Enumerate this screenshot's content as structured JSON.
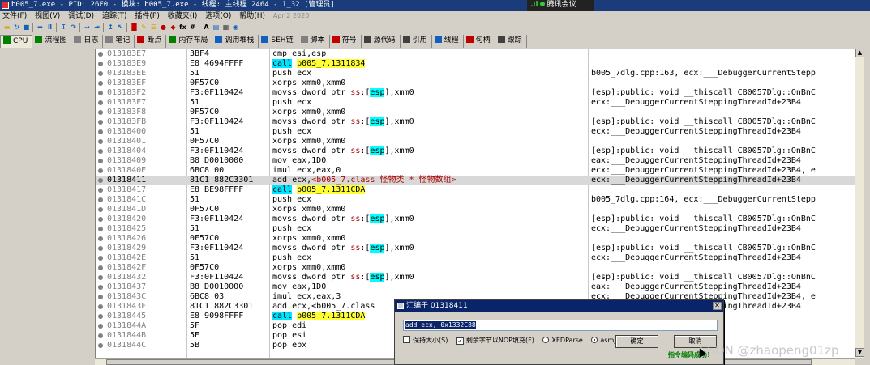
{
  "window": {
    "title": "b005_7.exe - PID: 26F0 - 模块: b005_7.exe - 线程: 主线程 2464 - 1_32 [管理员]",
    "meeting_label": "腾讯会议"
  },
  "menu": {
    "items": [
      "文件(F)",
      "视图(V)",
      "调试(D)",
      "追踪(T)",
      "插件(P)",
      "收藏夹(I)",
      "选项(O)",
      "帮助(H)"
    ],
    "date": "Apr 2 2020"
  },
  "toolbar": {
    "icons": [
      {
        "name": "open-icon",
        "color": "#d9a400",
        "glyph": "▬"
      },
      {
        "name": "restart-icon",
        "color": "#1060c0",
        "glyph": "↻"
      },
      {
        "name": "close-icon",
        "color": "#1060c0",
        "glyph": "■"
      },
      {
        "sep": true
      },
      {
        "name": "run-icon",
        "color": "#1060c0",
        "glyph": "➡"
      },
      {
        "name": "pause-icon",
        "color": "#1060c0",
        "glyph": "Ⅱ"
      },
      {
        "sep": true
      },
      {
        "name": "step-into-icon",
        "color": "#1060c0",
        "glyph": "↧"
      },
      {
        "name": "step-over-icon",
        "color": "#1060c0",
        "glyph": "↷"
      },
      {
        "sep": true
      },
      {
        "name": "trace-into-icon",
        "color": "#1060c0",
        "glyph": "⇢"
      },
      {
        "name": "trace-over-icon",
        "color": "#1060c0",
        "glyph": "⇥"
      },
      {
        "sep": true
      },
      {
        "name": "run-to-user-icon",
        "color": "#1060c0",
        "glyph": "↥"
      },
      {
        "name": "run-until-ret-icon",
        "color": "#1060c0",
        "glyph": "↖"
      },
      {
        "sep": true
      },
      {
        "name": "scylla-icon",
        "color": "#c00000",
        "glyph": "█"
      },
      {
        "name": "patch-icon",
        "color": "#d9a400",
        "glyph": "✎"
      },
      {
        "name": "script-icon",
        "color": "#d9a400",
        "glyph": "☰"
      },
      {
        "name": "breakpoint-icon",
        "color": "#c00000",
        "glyph": "●"
      },
      {
        "name": "hide-debugger-icon",
        "color": "#c00000",
        "glyph": "◆"
      },
      {
        "name": "function-icon",
        "color": "#000000",
        "glyph": "fx"
      },
      {
        "name": "hash-icon",
        "color": "#000000",
        "glyph": "#"
      },
      {
        "sep": true
      },
      {
        "name": "font-icon",
        "color": "#000000",
        "glyph": "A"
      },
      {
        "name": "clipboard-icon",
        "color": "#1060c0",
        "glyph": "▤"
      },
      {
        "name": "calculator-icon",
        "color": "#404040",
        "glyph": "▦"
      },
      {
        "name": "globe-icon",
        "color": "#1060c0",
        "glyph": "◉"
      }
    ]
  },
  "tabs": [
    {
      "label": "CPU",
      "icon": "cpu-icon",
      "color": "#008000",
      "active": true
    },
    {
      "label": "流程图",
      "icon": "graph-icon",
      "color": "#008000"
    },
    {
      "label": "日志",
      "icon": "log-icon",
      "color": "#808080"
    },
    {
      "label": "笔记",
      "icon": "notes-icon",
      "color": "#808080"
    },
    {
      "label": "断点",
      "icon": "breakpoint-tab-icon",
      "color": "#c00000"
    },
    {
      "label": "内存布局",
      "icon": "memory-icon",
      "color": "#008000"
    },
    {
      "label": "调用堆栈",
      "icon": "callstack-icon",
      "color": "#1060c0"
    },
    {
      "label": "SEH链",
      "icon": "seh-icon",
      "color": "#1060c0"
    },
    {
      "label": "脚本",
      "icon": "script-tab-icon",
      "color": "#808080"
    },
    {
      "label": "符号",
      "icon": "symbols-icon",
      "color": "#c00000"
    },
    {
      "label": "源代码",
      "icon": "source-icon",
      "color": "#404040"
    },
    {
      "label": "引用",
      "icon": "references-icon",
      "color": "#404040"
    },
    {
      "label": "线程",
      "icon": "threads-icon",
      "color": "#1060c0"
    },
    {
      "label": "句柄",
      "icon": "handles-icon",
      "color": "#c00000"
    },
    {
      "label": "跟踪",
      "icon": "trace-icon",
      "color": "#404040"
    }
  ],
  "disasm": {
    "rows": [
      {
        "addr": "013183E7",
        "hex": "3BF4",
        "dis": [
          {
            "t": "cmp esi,esp"
          }
        ],
        "cmt": ""
      },
      {
        "addr": "013183E9",
        "hex": "E8 4694FFFF",
        "dis": [
          {
            "t": "call",
            "c": "kw-call"
          },
          {
            "t": " "
          },
          {
            "t": "b005_7.1311834",
            "c": "sym"
          }
        ],
        "cmt": ""
      },
      {
        "addr": "013183EE",
        "hex": "51",
        "dis": [
          {
            "t": "push ecx"
          }
        ],
        "cmt": "b005_7dlg.cpp:163, ecx:___DebuggerCurrentStepp"
      },
      {
        "addr": "013183EF",
        "hex": "0F57C0",
        "dis": [
          {
            "t": "xorps xmm0,xmm0"
          }
        ],
        "cmt": ""
      },
      {
        "addr": "013183F2",
        "hex": "F3:0F110424",
        "dis": [
          {
            "t": "movss dword ptr "
          },
          {
            "t": "ss",
            "c": "seg"
          },
          {
            "t": ":["
          },
          {
            "t": "esp",
            "c": "memref"
          },
          {
            "t": "],xmm0"
          }
        ],
        "cmt": "[esp]:public: void __thiscall CB0057Dlg::OnBnC"
      },
      {
        "addr": "013183F7",
        "hex": "51",
        "dis": [
          {
            "t": "push ecx"
          }
        ],
        "cmt": "ecx:___DebuggerCurrentSteppingThreadId+23B4"
      },
      {
        "addr": "013183F8",
        "hex": "0F57C0",
        "dis": [
          {
            "t": "xorps xmm0,xmm0"
          }
        ],
        "cmt": ""
      },
      {
        "addr": "013183FB",
        "hex": "F3:0F110424",
        "dis": [
          {
            "t": "movss dword ptr "
          },
          {
            "t": "ss",
            "c": "seg"
          },
          {
            "t": ":["
          },
          {
            "t": "esp",
            "c": "memref"
          },
          {
            "t": "],xmm0"
          }
        ],
        "cmt": "[esp]:public: void __thiscall CB0057Dlg::OnBnC"
      },
      {
        "addr": "01318400",
        "hex": "51",
        "dis": [
          {
            "t": "push ecx"
          }
        ],
        "cmt": "ecx:___DebuggerCurrentSteppingThreadId+23B4"
      },
      {
        "addr": "01318401",
        "hex": "0F57C0",
        "dis": [
          {
            "t": "xorps xmm0,xmm0"
          }
        ],
        "cmt": ""
      },
      {
        "addr": "01318404",
        "hex": "F3:0F110424",
        "dis": [
          {
            "t": "movss dword ptr "
          },
          {
            "t": "ss",
            "c": "seg"
          },
          {
            "t": ":["
          },
          {
            "t": "esp",
            "c": "memref"
          },
          {
            "t": "],xmm0"
          }
        ],
        "cmt": "[esp]:public: void __thiscall CB0057Dlg::OnBnC"
      },
      {
        "addr": "01318409",
        "hex": "B8 D0010000",
        "dis": [
          {
            "t": "mov eax,1D0"
          }
        ],
        "cmt": "eax:___DebuggerCurrentSteppingThreadId+23B4"
      },
      {
        "addr": "0131840E",
        "hex": "6BC8 00",
        "dis": [
          {
            "t": "imul ecx,eax,0"
          }
        ],
        "cmt": "ecx:___DebuggerCurrentSteppingThreadId+23B4, e"
      },
      {
        "addr": "01318411",
        "hex": "81C1 882C3301",
        "hl": true,
        "dis": [
          {
            "t": "add ecx,"
          },
          {
            "t": "<b005_7.class 怪物类 * 怪物数组>",
            "c": "cls-comment"
          }
        ],
        "cmt": "ecx:___DebuggerCurrentSteppingThreadId+23B4"
      },
      {
        "addr": "01318417",
        "hex": "E8 BE98FFFF",
        "dis": [
          {
            "t": "call",
            "c": "kw-call"
          },
          {
            "t": " "
          },
          {
            "t": "b005_7.1311CDA",
            "c": "sym"
          }
        ],
        "cmt": ""
      },
      {
        "addr": "0131841C",
        "hex": "51",
        "dis": [
          {
            "t": "push ecx"
          }
        ],
        "cmt": "b005_7dlg.cpp:164, ecx:___DebuggerCurrentStepp"
      },
      {
        "addr": "0131841D",
        "hex": "0F57C0",
        "dis": [
          {
            "t": "xorps xmm0,xmm0"
          }
        ],
        "cmt": ""
      },
      {
        "addr": "01318420",
        "hex": "F3:0F110424",
        "dis": [
          {
            "t": "movss dword ptr "
          },
          {
            "t": "ss",
            "c": "seg"
          },
          {
            "t": ":["
          },
          {
            "t": "esp",
            "c": "memref"
          },
          {
            "t": "],xmm0"
          }
        ],
        "cmt": "[esp]:public: void __thiscall CB0057Dlg::OnBnC"
      },
      {
        "addr": "01318425",
        "hex": "51",
        "dis": [
          {
            "t": "push ecx"
          }
        ],
        "cmt": "ecx:___DebuggerCurrentSteppingThreadId+23B4"
      },
      {
        "addr": "01318426",
        "hex": "0F57C0",
        "dis": [
          {
            "t": "xorps xmm0,xmm0"
          }
        ],
        "cmt": ""
      },
      {
        "addr": "01318429",
        "hex": "F3:0F110424",
        "dis": [
          {
            "t": "movss dword ptr "
          },
          {
            "t": "ss",
            "c": "seg"
          },
          {
            "t": ":["
          },
          {
            "t": "esp",
            "c": "memref"
          },
          {
            "t": "],xmm0"
          }
        ],
        "cmt": "[esp]:public: void __thiscall CB0057Dlg::OnBnC"
      },
      {
        "addr": "0131842E",
        "hex": "51",
        "dis": [
          {
            "t": "push ecx"
          }
        ],
        "cmt": "ecx:___DebuggerCurrentSteppingThreadId+23B4"
      },
      {
        "addr": "0131842F",
        "hex": "0F57C0",
        "dis": [
          {
            "t": "xorps xmm0,xmm0"
          }
        ],
        "cmt": ""
      },
      {
        "addr": "01318432",
        "hex": "F3:0F110424",
        "dis": [
          {
            "t": "movss dword ptr "
          },
          {
            "t": "ss",
            "c": "seg"
          },
          {
            "t": ":["
          },
          {
            "t": "esp",
            "c": "memref"
          },
          {
            "t": "],xmm0"
          }
        ],
        "cmt": "[esp]:public: void __thiscall CB0057Dlg::OnBnC"
      },
      {
        "addr": "01318437",
        "hex": "B8 D0010000",
        "dis": [
          {
            "t": "mov eax,1D0"
          }
        ],
        "cmt": "eax:___DebuggerCurrentSteppingThreadId+23B4"
      },
      {
        "addr": "0131843C",
        "hex": "6BC8 03",
        "dis": [
          {
            "t": "imul ecx,eax,3"
          }
        ],
        "cmt": "ecx:___DebuggerCurrentSteppingThreadId+23B4, e"
      },
      {
        "addr": "0131843F",
        "hex": "81C1 882C3301",
        "dis": [
          {
            "t": "add ecx,<b005_7.class"
          }
        ],
        "cmt": "ecx:___DebuggerCurrentSteppingThreadId+23B4"
      },
      {
        "addr": "01318445",
        "hex": "E8 9098FFFF",
        "dis": [
          {
            "t": "call",
            "c": "kw-call"
          },
          {
            "t": " "
          },
          {
            "t": "b005_7.1311CDA",
            "c": "sym"
          }
        ],
        "cmt": ""
      },
      {
        "addr": "0131844A",
        "hex": "5F",
        "dis": [
          {
            "t": "pop edi"
          }
        ],
        "cmt": ""
      },
      {
        "addr": "0131844B",
        "hex": "5E",
        "dis": [
          {
            "t": "pop esi"
          }
        ],
        "cmt": ""
      },
      {
        "addr": "0131844C",
        "hex": "5B",
        "dis": [
          {
            "t": "pop ebx"
          }
        ],
        "cmt": ""
      }
    ]
  },
  "dialog": {
    "title": "汇编于 01318411",
    "input_value": "add ecx, 0x1332C88",
    "opt_keep_size": "保持大小(S)",
    "opt_fill_nop": "剩余字节以NOP填充(F)",
    "opt_xedparse": "XEDParse",
    "opt_asmjit": "asmjit",
    "ok_label": "确定",
    "cancel_label": "取消",
    "status": "指令编码成功!",
    "keep_size_checked": false,
    "fill_nop_checked": true,
    "engine": "asmjit"
  },
  "watermark": "CSDN @zhaopeng01zp"
}
